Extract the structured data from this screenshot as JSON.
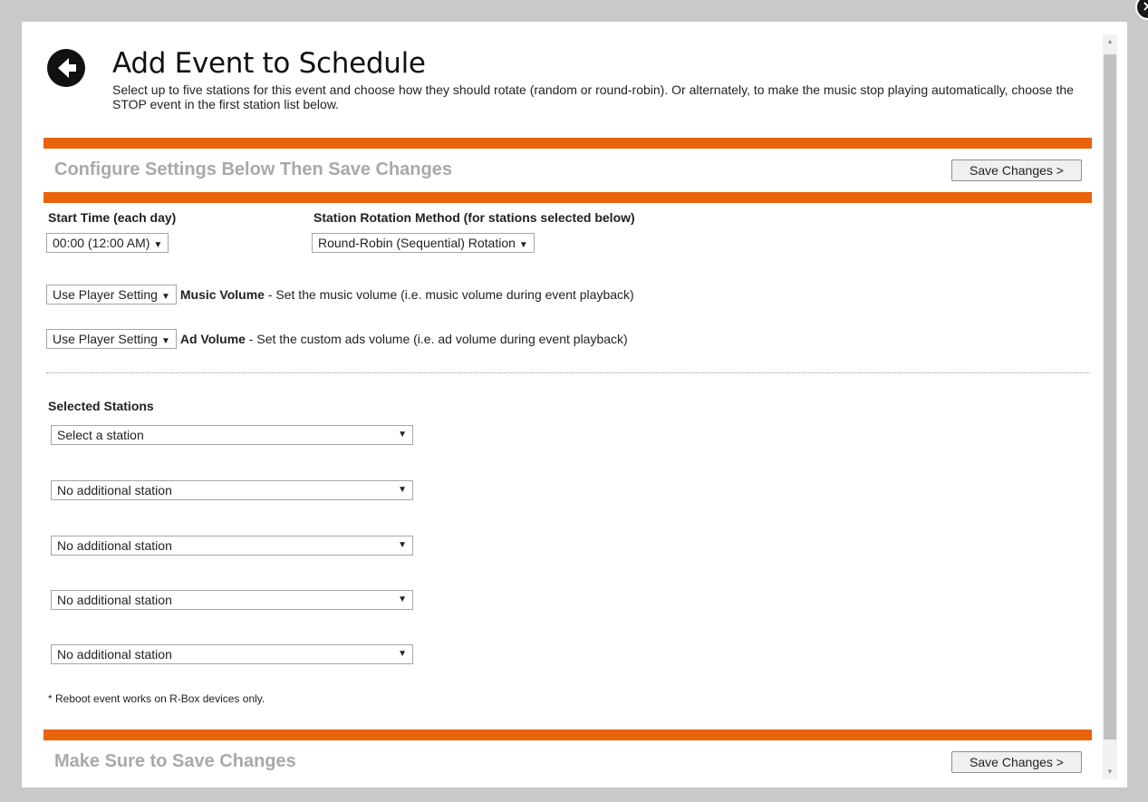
{
  "header": {
    "title": "Add Event to Schedule",
    "description": "Select up to five stations for this event and choose how they should rotate (random or round-robin). Or alternately, to make the music stop playing automatically, choose the STOP event in the first station list below."
  },
  "top_section": {
    "heading": "Configure Settings Below Then Save Changes",
    "save_label": "Save Changes >"
  },
  "start_time": {
    "label": "Start Time (each day)",
    "value": "00:00 (12:00 AM)"
  },
  "rotation": {
    "label": "Station Rotation Method (for stations selected below)",
    "value": "Round-Robin (Sequential) Rotation"
  },
  "music_volume": {
    "value": "Use Player Setting",
    "label": "Music Volume",
    "desc": " - Set the music volume (i.e. music volume during event playback)"
  },
  "ad_volume": {
    "value": "Use Player Setting",
    "label": "Ad Volume",
    "desc": " - Set the custom ads volume (i.e. ad volume during event playback)"
  },
  "stations": {
    "label": "Selected Stations",
    "selects": [
      "Select a station",
      "No additional station",
      "No additional station",
      "No additional station",
      "No additional station"
    ]
  },
  "footnote": "* Reboot event works on R-Box devices only.",
  "bottom_section": {
    "heading": "Make Sure to Save Changes",
    "save_label": "Save Changes >"
  },
  "icons": {
    "back": "arrow-left-circle-icon",
    "close": "close-icon",
    "dropdown": "caret-down-icon"
  },
  "colors": {
    "accent": "#e8630a",
    "heading_gray": "#a9a9a9"
  }
}
